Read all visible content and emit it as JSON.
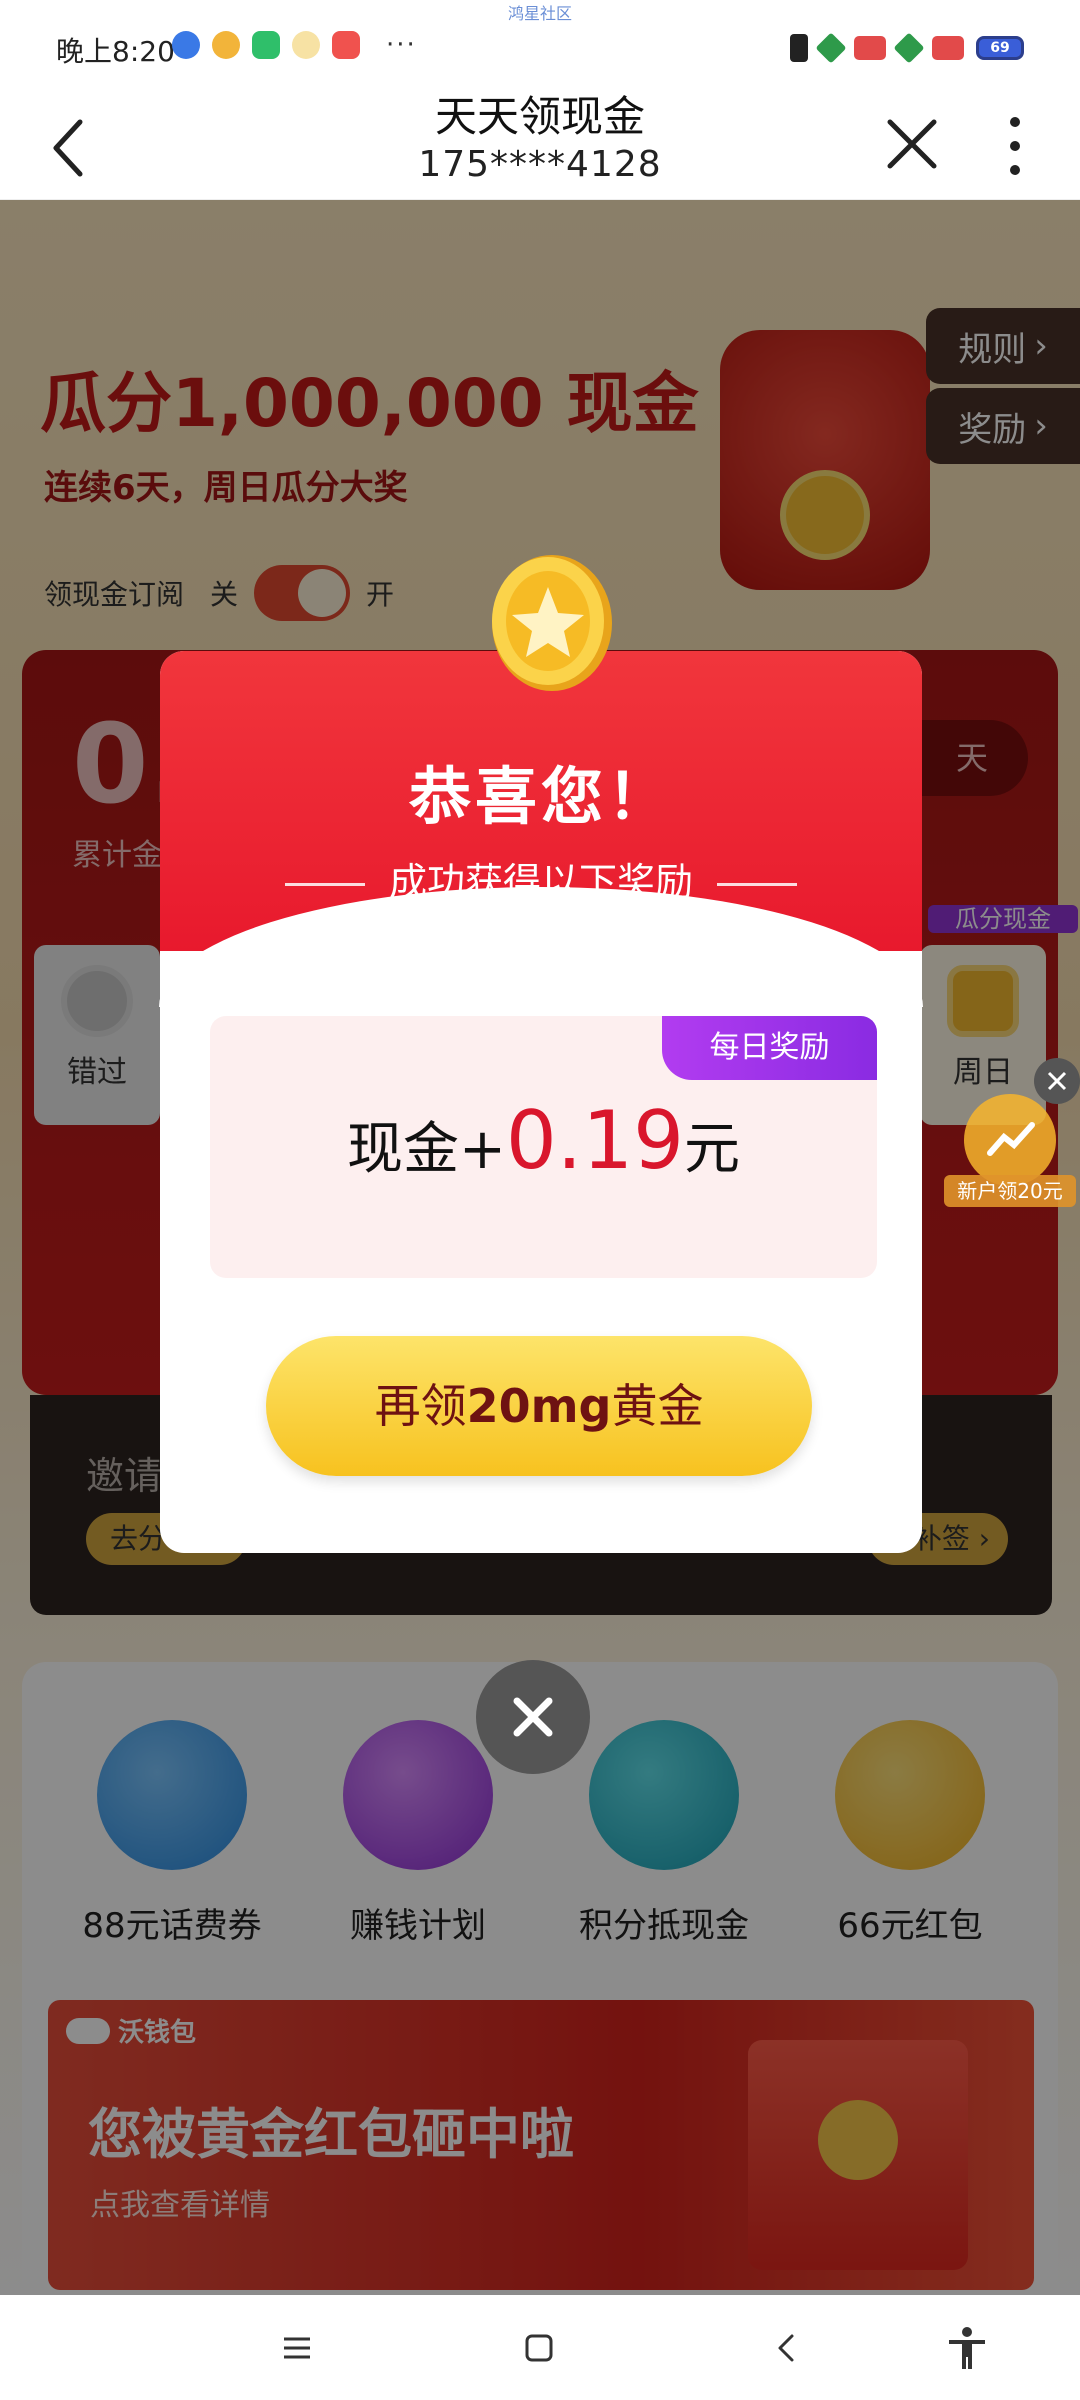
{
  "status_bar": {
    "time": "晚上8:20",
    "watermark": "鸿星社区",
    "battery": "69"
  },
  "header": {
    "title": "天天领现金",
    "subtitle": "175****4128"
  },
  "hero": {
    "headline": "瓜分1,000,000 现金",
    "sub": "连续6天，周日瓜分大奖",
    "subscribe_label": "领现金订阅",
    "toggle_off": "关",
    "toggle_on": "开",
    "rules": "规则",
    "rewards": "奖励"
  },
  "progress_card": {
    "amount": "0.",
    "caption": "累计金",
    "days_pill": "天",
    "missed_label": "错过",
    "sunday_label": "周日",
    "gold_badge": "瓜分现金"
  },
  "invite_card": {
    "text": "邀请",
    "left_pill": "去分",
    "right_pill": "补签"
  },
  "popup": {
    "congrats": "恭喜您！",
    "subline": "成功获得以下奖励",
    "tag": "每日奖励",
    "amount_prefix": "现金+",
    "amount_value": "0.19",
    "amount_unit": "元",
    "cta_prefix": "再领",
    "cta_bold": "20mg",
    "cta_suffix": "黄金"
  },
  "functions": [
    {
      "label": "88元话费券",
      "icon": "phone-voucher-icon",
      "color": "#4aa4f0"
    },
    {
      "label": "赚钱计划",
      "icon": "earn-plan-icon",
      "color": "#b04ee6"
    },
    {
      "label": "积分抵现金",
      "icon": "points-cash-icon",
      "color": "#2cb8c9"
    },
    {
      "label": "66元红包",
      "icon": "red-packet-icon",
      "color": "#f6c13a"
    }
  ],
  "promo": {
    "brand": "沃钱包",
    "headline": "您被黄金红包砸中啦",
    "sub": "点我查看详情"
  },
  "floating_badge": {
    "text": "新户领20元"
  }
}
